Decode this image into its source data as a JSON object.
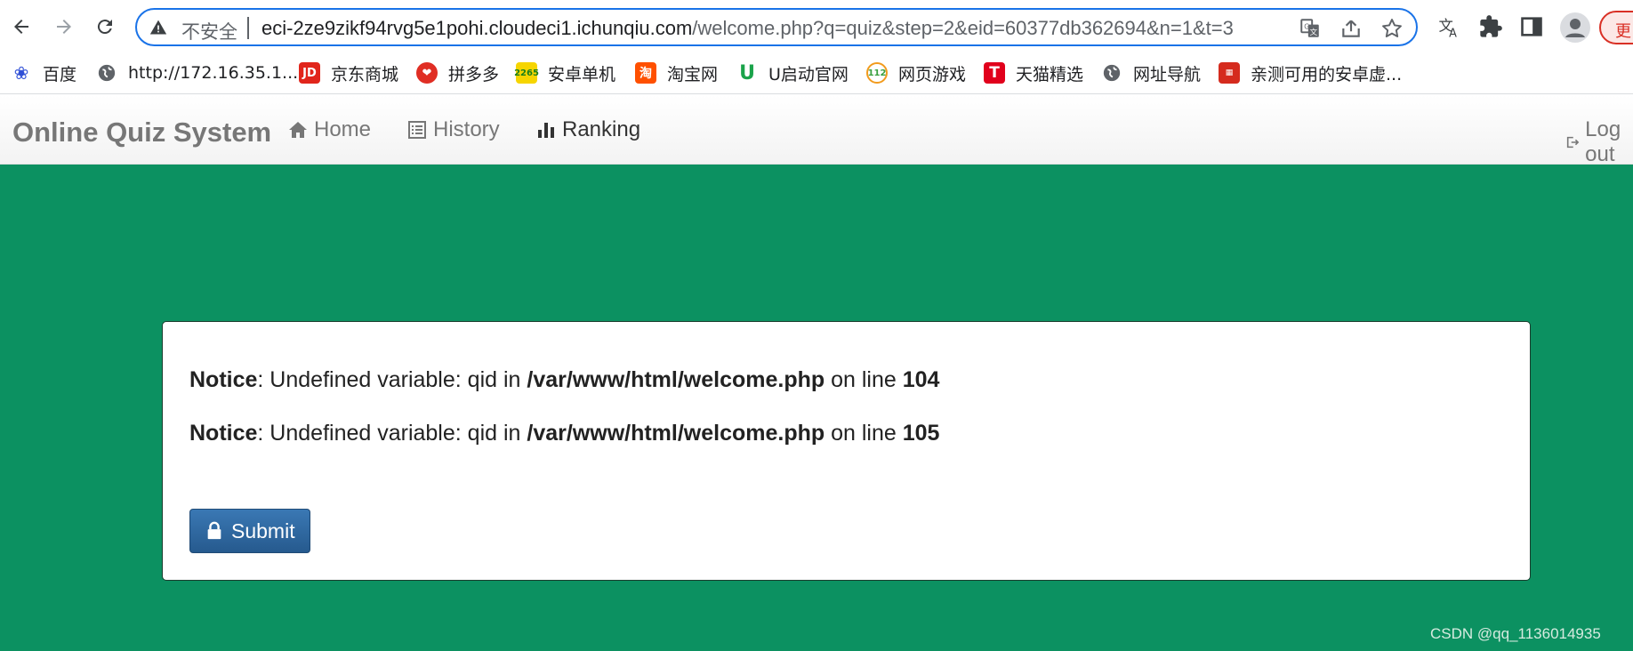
{
  "browser": {
    "address_bar": {
      "security_label": "不安全",
      "url_host": "eci-2ze9zikf94rvg5e1pohi.cloudeci1.ichunqiu.com",
      "url_path": "/welcome.php?q=quiz&step=2&eid=60377db362694&n=1&t=3"
    },
    "update_label": "更",
    "bookmarks": [
      {
        "label": "百度",
        "icon": "baidu-paw-icon"
      },
      {
        "label": "http://172.16.35.1...",
        "icon": "globe-icon"
      },
      {
        "label": "京东商城",
        "icon": "jd-logo-icon"
      },
      {
        "label": "拼多多",
        "icon": "pinduoduo-logo-icon"
      },
      {
        "label": "安卓单机",
        "icon": "2265-logo-icon"
      },
      {
        "label": "淘宝网",
        "icon": "taobao-logo-icon"
      },
      {
        "label": "U启动官网",
        "icon": "u-logo-icon"
      },
      {
        "label": "网页游戏",
        "icon": "game-logo-icon"
      },
      {
        "label": "天猫精选",
        "icon": "tmall-logo-icon"
      },
      {
        "label": "网址导航",
        "icon": "globe-icon"
      },
      {
        "label": "亲测可用的安卓虚...",
        "icon": "app-logo-icon"
      }
    ],
    "colors": {
      "focus": "#1a73e8",
      "update": "#d93025"
    }
  },
  "site": {
    "brand": "Online Quiz System",
    "nav": {
      "home": "Home",
      "history": "History",
      "ranking": "Ranking",
      "logout": "Log out"
    },
    "notices": [
      {
        "label": "Notice",
        "message": ": Undefined variable: qid in ",
        "file": "/var/www/html/welcome.php",
        "on_line": " on line ",
        "line": "104"
      },
      {
        "label": "Notice",
        "message": ": Undefined variable: qid in ",
        "file": "/var/www/html/welcome.php",
        "on_line": " on line ",
        "line": "105"
      }
    ],
    "submit_label": "Submit",
    "colors": {
      "background": "#0c9161",
      "button": "#2f6aa3"
    }
  },
  "watermark": "CSDN @qq_1136014935"
}
